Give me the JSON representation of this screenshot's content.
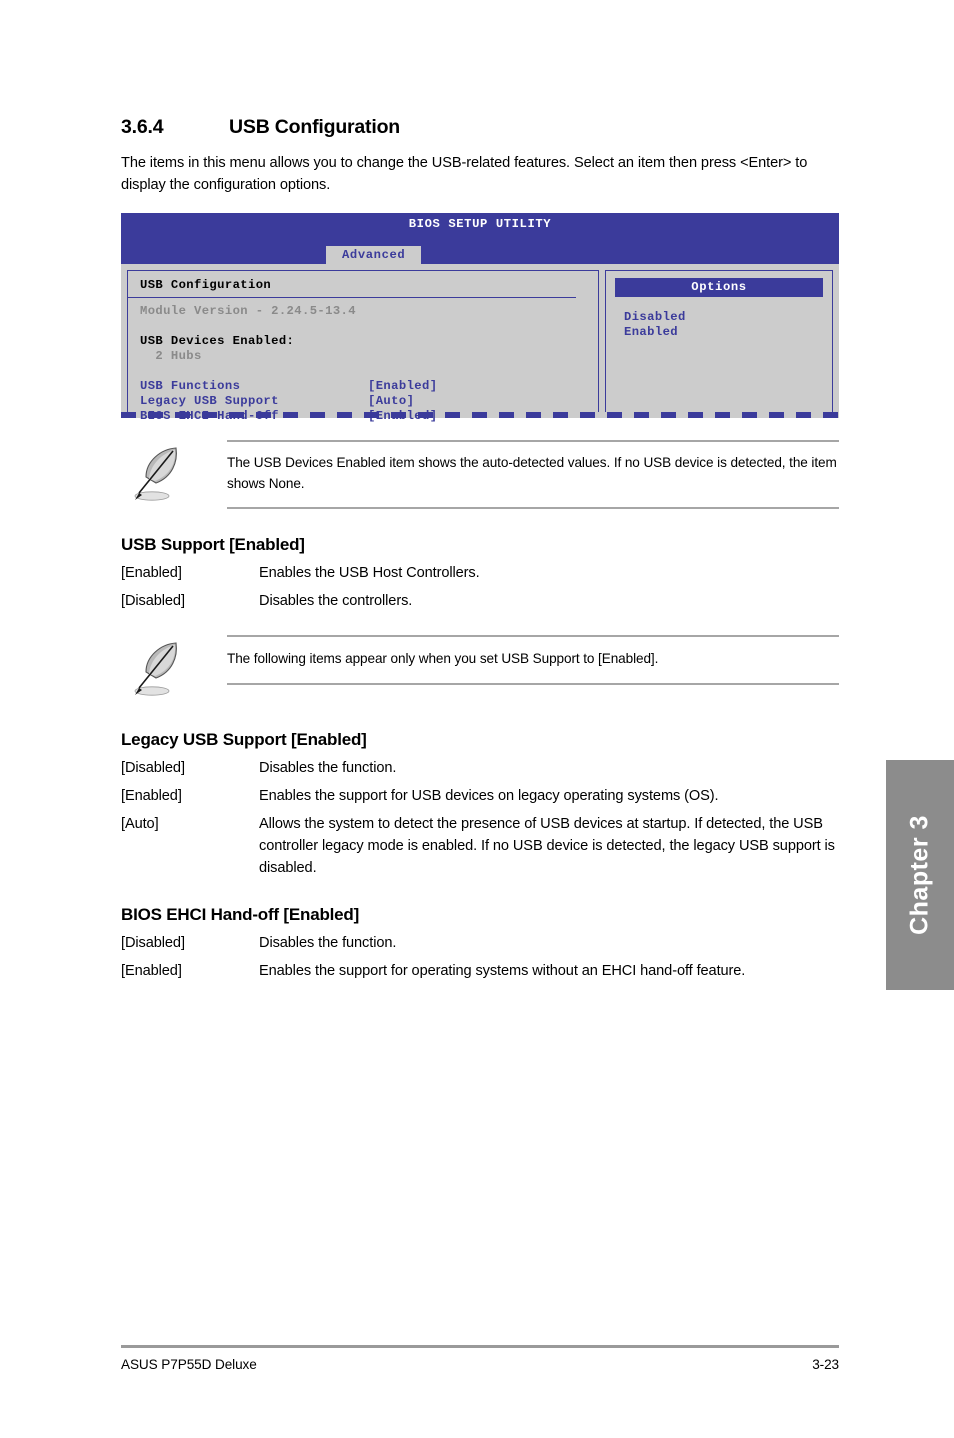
{
  "section": {
    "number": "3.6.4",
    "title": "USB Configuration",
    "intro": "The items in this menu allows you to change the USB-related features. Select an item then press <Enter> to display the configuration options."
  },
  "bios_screen": {
    "title": "BIOS SETUP UTILITY",
    "active_tab": "Advanced",
    "left_panel": {
      "heading": "USB Configuration",
      "module_version": "Module Version - 2.24.5-13.4",
      "devices_label": "USB Devices Enabled:",
      "devices_value": "  2 Hubs",
      "items": [
        {
          "label": "USB Functions",
          "value": "[Enabled]"
        },
        {
          "label": "Legacy USB Support",
          "value": "[Auto]"
        },
        {
          "label": "BIOS EHCI Hand-Off",
          "value": "[Enabled]"
        }
      ]
    },
    "options_panel": {
      "heading": "Options",
      "options": [
        "Disabled",
        "Enabled"
      ]
    },
    "colors": {
      "header_blue": "#3b3b9b",
      "body_gray": "#cccccc",
      "muted_gray": "#8a8a8a"
    }
  },
  "note_1": "The USB Devices Enabled item shows the auto-detected values. If no USB device is detected, the item shows None.",
  "note_2": "The following items appear only when you set USB Support to [Enabled].",
  "usb_support": {
    "title": "USB Support [Enabled]",
    "rows": [
      {
        "term": "[Enabled]",
        "desc": "Enables the USB Host Controllers."
      },
      {
        "term": "[Disabled]",
        "desc": "Disables the controllers."
      }
    ]
  },
  "legacy_usb_support": {
    "title": "Legacy USB Support [Enabled]",
    "rows": [
      {
        "term": "[Disabled]",
        "desc": "Disables the function."
      },
      {
        "term": "[Enabled]",
        "desc": "Enables the support for USB devices on legacy operating systems (OS)."
      },
      {
        "term": "[Auto]",
        "desc": "Allows the system to detect the presence of USB devices at startup. If detected, the USB controller legacy mode is enabled. If no USB device is detected, the legacy USB support is disabled."
      }
    ]
  },
  "bios_ehci_handoff": {
    "title": "BIOS EHCI Hand-off [Enabled]",
    "rows": [
      {
        "term": "[Disabled]",
        "desc": "Disables the function."
      },
      {
        "term": "[Enabled]",
        "desc": "Enables the support for operating systems without an EHCI hand-off feature."
      }
    ]
  },
  "chapter_tab": {
    "label": "Chapter 3"
  },
  "footer": {
    "left": "ASUS P7P55D Deluxe",
    "right": "3-23"
  }
}
